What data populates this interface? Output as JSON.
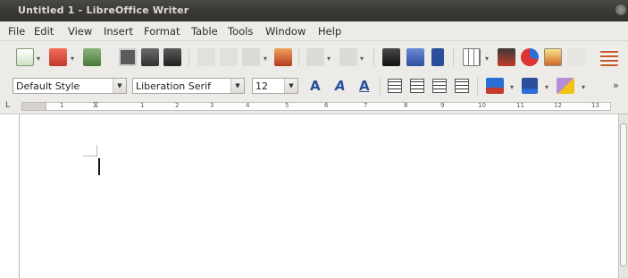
{
  "window": {
    "title": "Untitled 1 - LibreOffice Writer"
  },
  "menu": [
    "File",
    "Edit",
    "View",
    "Insert",
    "Format",
    "Table",
    "Tools",
    "Window",
    "Help"
  ],
  "standard_toolbar": {
    "icons": [
      "new-document-icon",
      "open-folder-icon",
      "save-icon",
      "export-pdf-icon",
      "print-icon",
      "print-preview-icon",
      "cut-icon",
      "copy-icon",
      "paste-icon",
      "clone-formatting-icon",
      "undo-icon",
      "redo-icon",
      "find-replace-icon",
      "spellcheck-icon",
      "formatting-marks-icon",
      "insert-table-icon",
      "insert-image-icon",
      "insert-chart-icon",
      "draw-functions-icon",
      "fontwork-icon",
      "navigator-icon"
    ]
  },
  "format_toolbar": {
    "paragraph_style": "Default Style",
    "font_name": "Liberation Serif",
    "font_size": "12",
    "bold": "A",
    "italic": "A",
    "underline": "A",
    "overflow": "»"
  },
  "ruler": {
    "numbers": [
      "1",
      "1",
      "2",
      "3",
      "4",
      "5",
      "6",
      "7",
      "8",
      "9",
      "10",
      "11",
      "12",
      "13"
    ]
  },
  "colors": {
    "titlebar": "#3a3936",
    "chrome": "#edebe7",
    "accent_blue": "#2a4f9b"
  }
}
